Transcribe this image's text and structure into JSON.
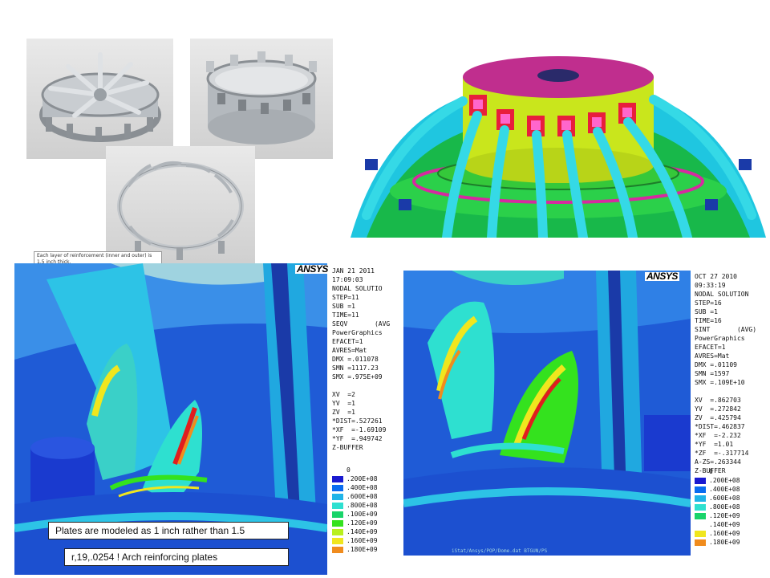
{
  "cad_note": "Each layer of reinforcement (inner and outer) is 1.5 inch thick.",
  "left_plot": {
    "logo": "ANSYS",
    "lines": [
      "JAN 21 2011",
      "17:09:03",
      "NODAL SOLUTIO",
      "STEP=11",
      "SUB =1",
      "TIME=11",
      "SEQV       (AVG",
      "PowerGraphics",
      "EFACET=1",
      "AVRES=Mat",
      "DMX =.011078",
      "SMN =1117.23",
      "SMX =.975E+09",
      "",
      "XV  =2",
      "YV  =1",
      "ZV  =1",
      "*DIST=.527261",
      "*XF  =-1.69109",
      "*YF  =.949742",
      "Z-BUFFER"
    ],
    "legend": [
      "0",
      ".200E+08",
      ".400E+08",
      ".600E+08",
      ".800E+08",
      ".100E+09",
      ".120E+09",
      ".140E+09",
      ".160E+09",
      ".180E+09"
    ]
  },
  "right_plot": {
    "logo": "ANSYS",
    "lines": [
      "OCT 27 2010",
      "09:33:19",
      "NODAL SOLUTION",
      "STEP=16",
      "SUB =1",
      "TIME=16",
      "SINT       (AVG)",
      "PowerGraphics",
      "EFACET=1",
      "AVRES=Mat",
      "DMX =.01109",
      "SMN =1597",
      "SMX =.109E+10",
      "",
      "XV  =.862703",
      "YV  =.272842",
      "ZV  =.425794",
      "*DIST=.462837",
      "*XF  =-2.232",
      "*YF  =1.01",
      "*ZF  =-.317714",
      "A-ZS=.263344",
      "Z-BUFFER"
    ],
    "legend": [
      "0",
      ".200E+08",
      ".400E+08",
      ".600E+08",
      ".800E+08",
      ".120E+09",
      ".140E+09",
      ".160E+09",
      ".180E+09"
    ]
  },
  "legend_colors": [
    "#1a1ad0",
    "#0a6cf0",
    "#1fb4e8",
    "#2ee0d0",
    "#19d46a",
    "#34e21e",
    "#b8f01e",
    "#f0e61e",
    "#f08c1e",
    "#e01e1e"
  ],
  "right_legend_colors": [
    "#1a1ad0",
    "#0a6cf0",
    "#1fb4e8",
    "#2ee0d0",
    "#19d46a",
    "#ffffff",
    "#f0e61e",
    "#f08c1e",
    "#e01e1e"
  ],
  "captions": {
    "plates": "Plates are modeled as 1 inch rather than 1.5",
    "arch": "r,19,.0254    ! Arch reinforcing plates"
  },
  "right_footer": "iStat/Ansys/POP/Dome.dat  BTGUN/PS"
}
